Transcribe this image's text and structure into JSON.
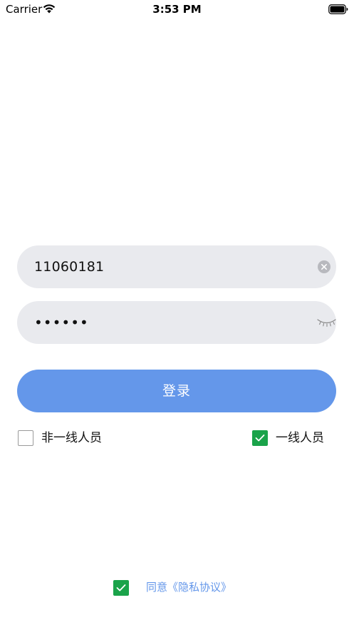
{
  "status_bar": {
    "carrier": "Carrier",
    "time": "3:53 PM",
    "wifi_icon": "wifi-icon",
    "battery_icon": "battery-icon"
  },
  "login_form": {
    "username": {
      "value": "11060181",
      "clear_icon": "clear-circle-icon"
    },
    "password": {
      "masked_value": "••••••",
      "visibility_icon": "eye-closed-icon"
    },
    "submit_label": "登录",
    "roles": [
      {
        "label": "非一线人员",
        "checked": false
      },
      {
        "label": "一线人员",
        "checked": true
      }
    ]
  },
  "privacy": {
    "agreed": true,
    "label": "同意《隐私协议》"
  },
  "colors": {
    "accent": "#6497ea",
    "checkbox_checked": "#1aa34a",
    "field_background": "#e9eaee"
  }
}
